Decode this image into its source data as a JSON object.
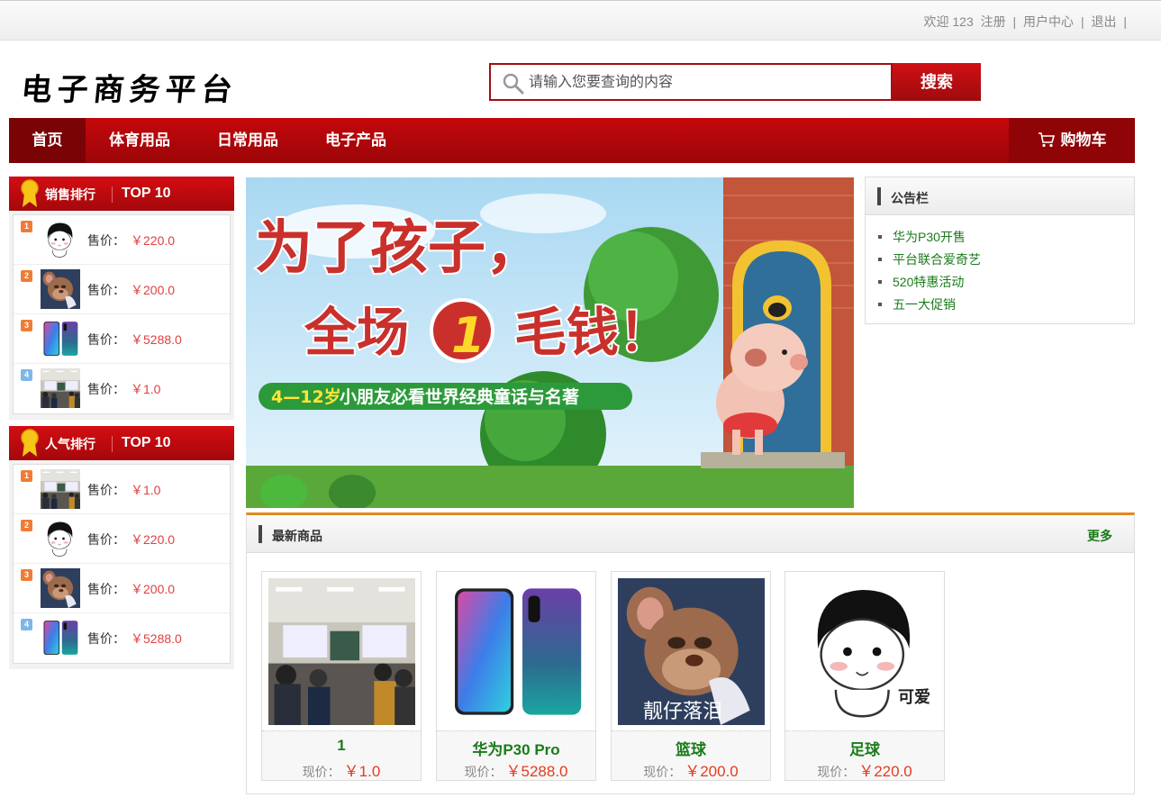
{
  "topbar": {
    "welcome": "欢迎 123",
    "register": "注册",
    "sep1": "|",
    "user_center": "用户中心",
    "sep2": "|",
    "logout": "退出",
    "sep3": "|"
  },
  "logo": {
    "text": "电子商务平台"
  },
  "search": {
    "placeholder": "请输入您要查询的内容",
    "button": "搜索"
  },
  "nav": {
    "items": [
      "首页",
      "体育用品",
      "日常用品",
      "电子产品"
    ],
    "cart": "购物车"
  },
  "sales_rank": {
    "title": "销售排行",
    "top": "TOP 10",
    "items": [
      {
        "rank": "1",
        "image": "cute-cartoon",
        "price_label": "售价：",
        "price": "￥220.0"
      },
      {
        "rank": "2",
        "image": "jerry-mouse",
        "price_label": "售价：",
        "price": "￥200.0"
      },
      {
        "rank": "3",
        "image": "huawei-phone",
        "price_label": "售价：",
        "price": "￥5288.0"
      },
      {
        "rank": "4",
        "image": "classroom",
        "price_label": "售价：",
        "price": "￥1.0"
      }
    ]
  },
  "popular_rank": {
    "title": "人气排行",
    "top": "TOP 10",
    "items": [
      {
        "rank": "1",
        "image": "classroom",
        "price_label": "售价：",
        "price": "￥1.0"
      },
      {
        "rank": "2",
        "image": "cute-cartoon",
        "price_label": "售价：",
        "price": "￥220.0"
      },
      {
        "rank": "3",
        "image": "jerry-mouse",
        "price_label": "售价：",
        "price": "￥200.0"
      },
      {
        "rank": "4",
        "image": "huawei-phone",
        "price_label": "售价：",
        "price": "￥5288.0"
      }
    ]
  },
  "banner": {
    "line1": "为了孩子，",
    "line2a": "全场",
    "line2b": "1",
    "line2c": "毛钱！",
    "tagline_age": "4—12岁",
    "tagline": "小朋友必看世界经典童话与名著"
  },
  "notice": {
    "title": "公告栏",
    "items": [
      "华为P30开售",
      "平台联合爱奇艺",
      "520特惠活动",
      "五一大促销"
    ]
  },
  "newest": {
    "title": "最新商品",
    "more": "更多",
    "products": [
      {
        "name": "1",
        "price_label": "现价：",
        "price": "￥1.0",
        "image": "classroom"
      },
      {
        "name": "华为P30 Pro",
        "price_label": "现价：",
        "price": "￥5288.0",
        "image": "huawei-phone"
      },
      {
        "name": "篮球",
        "price_label": "现价：",
        "price": "￥200.0",
        "image": "jerry-mouse",
        "caption": "靓仔落泪"
      },
      {
        "name": "足球",
        "price_label": "现价：",
        "price": "￥220.0",
        "image": "cute-cartoon",
        "caption": "可爱"
      }
    ]
  },
  "colors": {
    "brand_red": "#c4080c",
    "price_red": "#e43b1e",
    "green": "#1a7b1a",
    "accent_orange": "#e3891a"
  }
}
